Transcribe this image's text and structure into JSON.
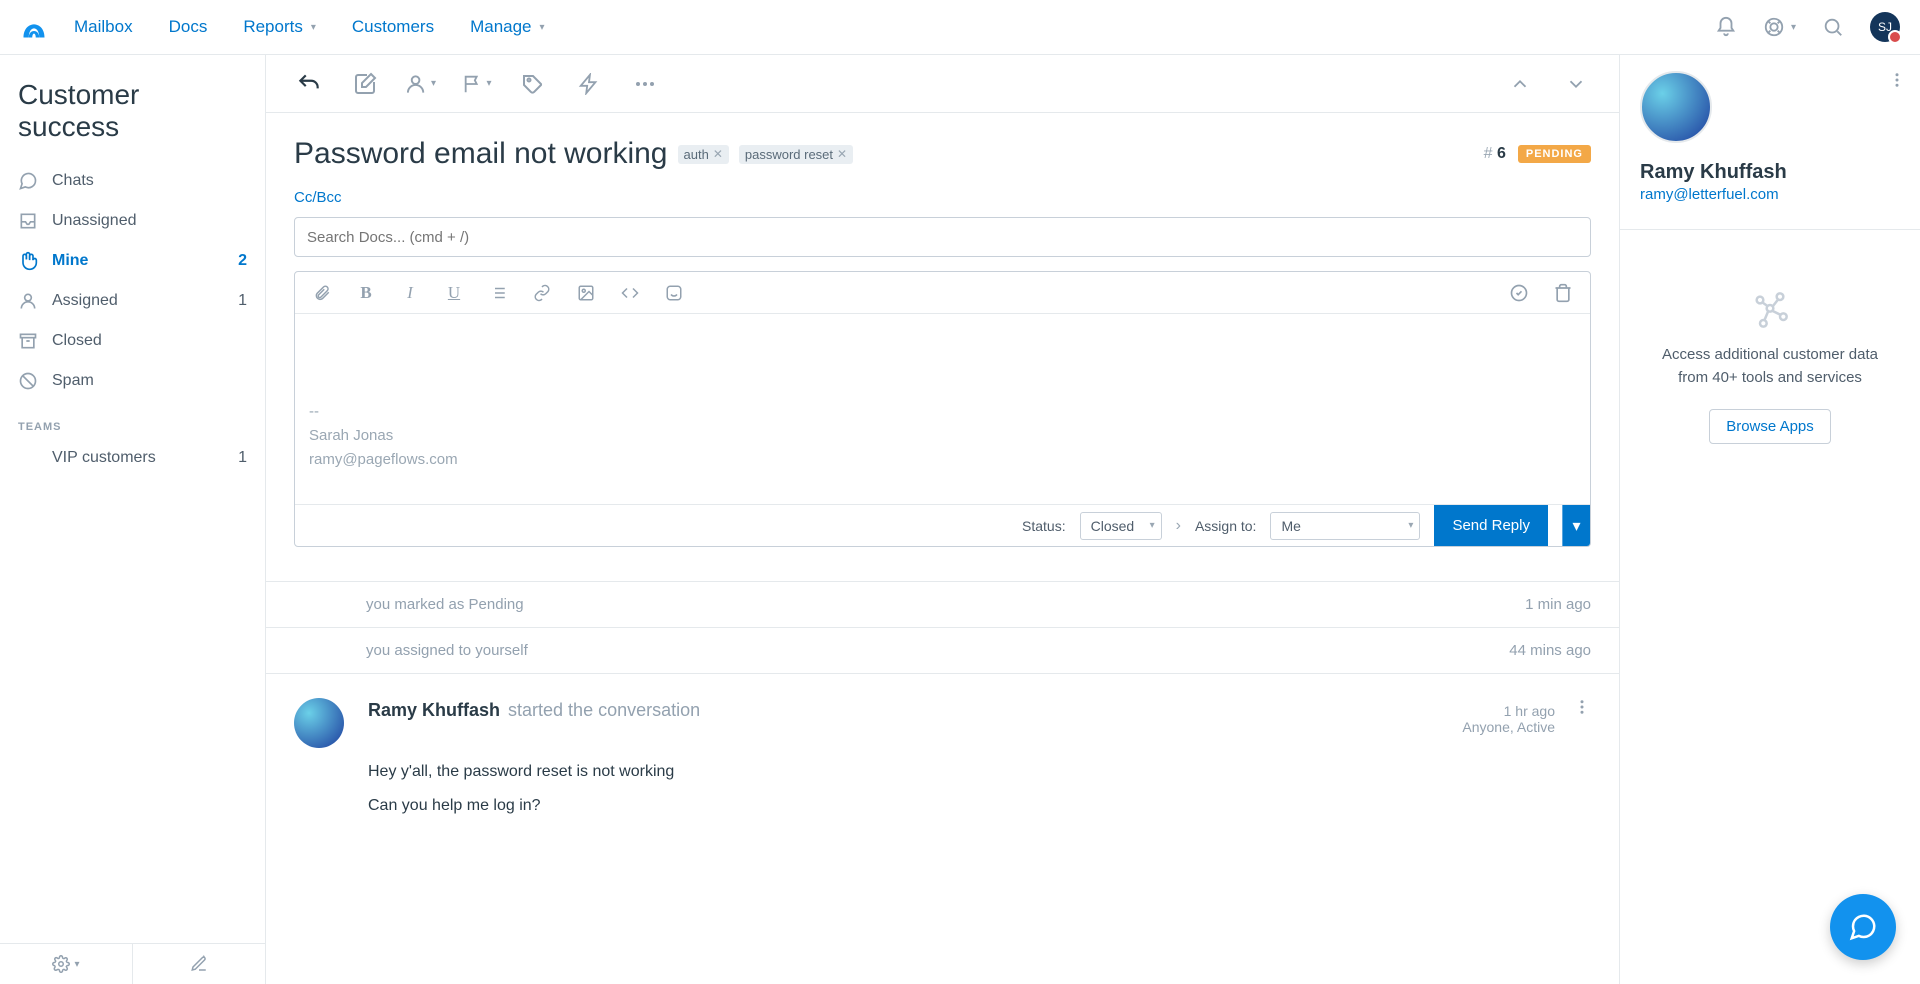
{
  "nav": {
    "items": [
      "Mailbox",
      "Docs",
      "Reports",
      "Customers",
      "Manage"
    ],
    "avatar_initials": "SJ"
  },
  "sidebar": {
    "title": "Customer success",
    "items": [
      {
        "icon": "chat",
        "label": "Chats",
        "count": ""
      },
      {
        "icon": "inbox",
        "label": "Unassigned",
        "count": ""
      },
      {
        "icon": "hand",
        "label": "Mine",
        "count": "2",
        "active": true
      },
      {
        "icon": "user",
        "label": "Assigned",
        "count": "1"
      },
      {
        "icon": "archive",
        "label": "Closed",
        "count": ""
      },
      {
        "icon": "ban",
        "label": "Spam",
        "count": ""
      }
    ],
    "teams_heading": "TEAMS",
    "teams": [
      {
        "label": "VIP customers",
        "count": "1"
      }
    ]
  },
  "conversation": {
    "title": "Password email not working",
    "tags": [
      "auth",
      "password reset"
    ],
    "number_prefix": "#",
    "number": "6",
    "status": "PENDING",
    "ccbcc": "Cc/Bcc",
    "search_placeholder": "Search Docs... (cmd + /)",
    "signature_dashes": "--",
    "signature_name": "Sarah Jonas",
    "signature_email": "ramy@pageflows.com",
    "status_label": "Status:",
    "status_value": "Closed",
    "assign_label": "Assign to:",
    "assign_value": "Me",
    "send_label": "Send Reply"
  },
  "activity": [
    {
      "text": "you marked as Pending",
      "time": "1 min ago"
    },
    {
      "text": "you assigned to yourself",
      "time": "44 mins ago"
    }
  ],
  "thread": {
    "author": "Ramy Khuffash",
    "action": "started the conversation",
    "time": "1 hr ago",
    "visibility": "Anyone, Active",
    "line1": "Hey y'all, the password reset is not working",
    "line2": "Can you help me log in?"
  },
  "profile": {
    "name": "Ramy Khuffash",
    "email": "ramy@letterfuel.com"
  },
  "apps": {
    "line": "Access additional customer data from 40+ tools and services",
    "cta": "Browse Apps"
  }
}
